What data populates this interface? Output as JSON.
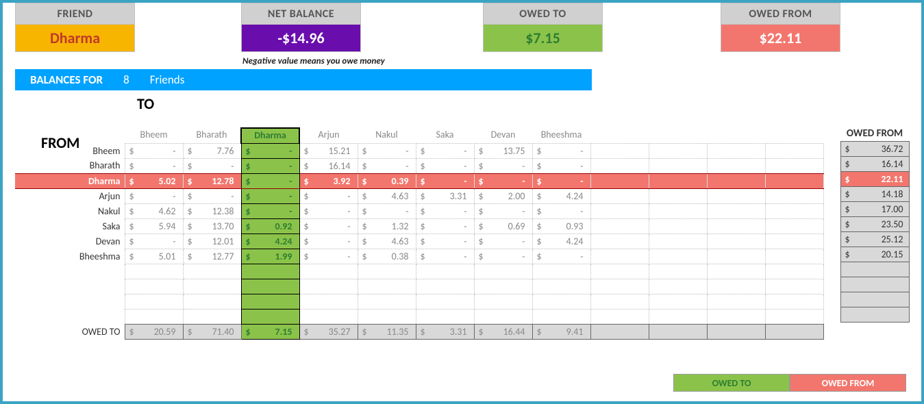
{
  "summary": {
    "friend_label": "FRIEND",
    "friend_value": "Dharma",
    "net_label": "NET BALANCE",
    "net_value": "-$14.96",
    "net_note": "Negative value means you owe money",
    "owed_to_label": "OWED TO",
    "owed_to_value": "$7.15",
    "owed_from_label": "OWED FROM",
    "owed_from_value": "$22.11"
  },
  "bar": {
    "label": "BALANCES FOR",
    "count": "8",
    "friends": "Friends"
  },
  "axis": {
    "to": "TO",
    "from": "FROM"
  },
  "friends": [
    "Bheem",
    "Bharath",
    "Dharma",
    "Arjun",
    "Nakul",
    "Saka",
    "Devan",
    "Bheeshma"
  ],
  "highlight_index": 2,
  "matrix": [
    [
      "-",
      "7.76",
      "-",
      "15.21",
      "-",
      "-",
      "13.75",
      "-"
    ],
    [
      "-",
      "-",
      "-",
      "16.14",
      "-",
      "-",
      "-",
      "-"
    ],
    [
      "5.02",
      "12.78",
      "-",
      "3.92",
      "0.39",
      "-",
      "-",
      "-"
    ],
    [
      "-",
      "-",
      "-",
      "-",
      "4.63",
      "3.31",
      "2.00",
      "4.24"
    ],
    [
      "4.62",
      "12.38",
      "-",
      "-",
      "-",
      "-",
      "-",
      "-"
    ],
    [
      "5.94",
      "13.70",
      "0.92",
      "-",
      "1.32",
      "-",
      "0.69",
      "0.93"
    ],
    [
      "-",
      "12.01",
      "4.24",
      "-",
      "4.63",
      "-",
      "-",
      "4.24"
    ],
    [
      "5.01",
      "12.77",
      "1.99",
      "-",
      "0.38",
      "-",
      "-",
      "-"
    ]
  ],
  "blank_rows": 4,
  "extra_cols": 4,
  "owed_to_label": "OWED TO",
  "owed_to_row": [
    "20.59",
    "71.40",
    "7.15",
    "35.27",
    "11.35",
    "3.31",
    "16.44",
    "9.41"
  ],
  "owed_from_label": "OWED FROM",
  "owed_from_col": [
    "36.72",
    "16.14",
    "22.11",
    "14.18",
    "17.00",
    "23.50",
    "25.12",
    "20.15"
  ],
  "owed_from_blank": 4,
  "legend": {
    "to": "OWED TO",
    "from": "OWED FROM"
  },
  "chart_data": {
    "type": "table",
    "title": "Balance matrix between friends",
    "row_labels": [
      "Bheem",
      "Bharath",
      "Dharma",
      "Arjun",
      "Nakul",
      "Saka",
      "Devan",
      "Bheeshma"
    ],
    "col_labels": [
      "Bheem",
      "Bharath",
      "Dharma",
      "Arjun",
      "Nakul",
      "Saka",
      "Devan",
      "Bheeshma"
    ],
    "values": [
      [
        null,
        7.76,
        null,
        15.21,
        null,
        null,
        13.75,
        null
      ],
      [
        null,
        null,
        null,
        16.14,
        null,
        null,
        null,
        null
      ],
      [
        5.02,
        12.78,
        null,
        3.92,
        0.39,
        null,
        null,
        null
      ],
      [
        null,
        null,
        null,
        null,
        4.63,
        3.31,
        2.0,
        4.24
      ],
      [
        4.62,
        12.38,
        null,
        null,
        null,
        null,
        null,
        null
      ],
      [
        5.94,
        13.7,
        0.92,
        null,
        1.32,
        null,
        0.69,
        0.93
      ],
      [
        null,
        12.01,
        4.24,
        null,
        4.63,
        null,
        null,
        4.24
      ],
      [
        5.01,
        12.77,
        1.99,
        null,
        0.38,
        null,
        null,
        null
      ]
    ],
    "col_totals_label": "OWED TO",
    "col_totals": [
      20.59,
      71.4,
      7.15,
      35.27,
      11.35,
      3.31,
      16.44,
      9.41
    ],
    "row_totals_label": "OWED FROM",
    "row_totals": [
      36.72,
      16.14,
      22.11,
      14.18,
      17.0,
      23.5,
      25.12,
      20.15
    ],
    "highlighted_friend": "Dharma",
    "net_balance": -14.96,
    "owed_to_highlight": 7.15,
    "owed_from_highlight": 22.11
  }
}
